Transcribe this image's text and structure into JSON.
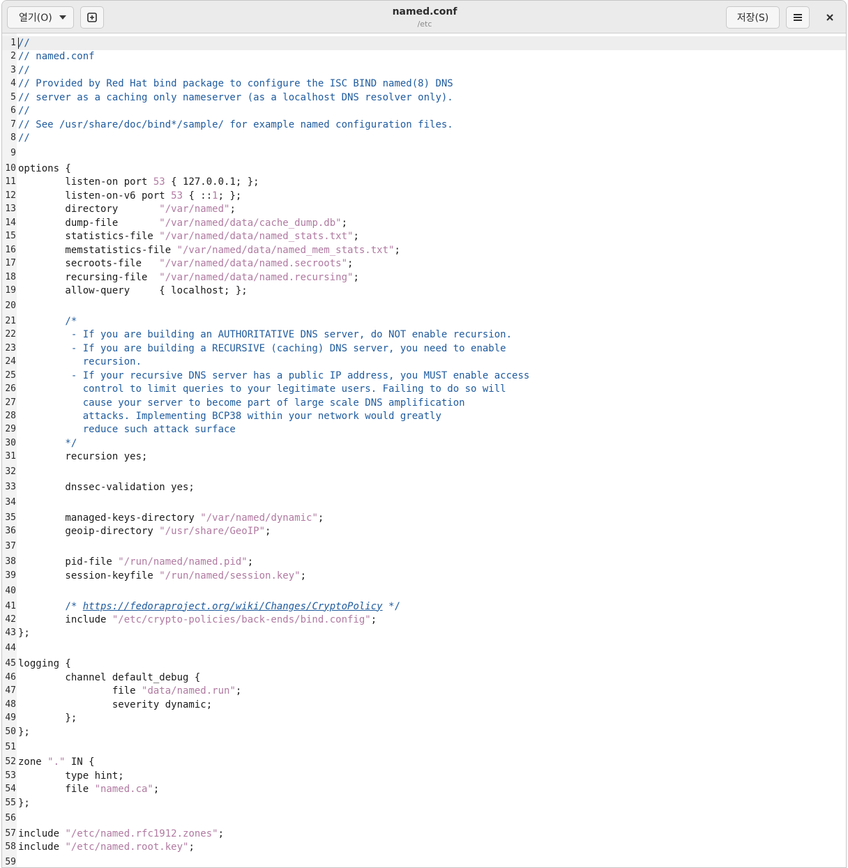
{
  "header": {
    "open_label": "열기(O)",
    "save_label": "저장(S)",
    "title": "named.conf",
    "subtitle": "/etc",
    "new_tab_icon": "new-tab-icon",
    "menu_icon": "hamburger-menu-icon",
    "close_icon": "close-icon"
  },
  "editor": {
    "lines": [
      [
        [
          "c",
          "//"
        ]
      ],
      [
        [
          "c",
          "// named.conf"
        ]
      ],
      [
        [
          "c",
          "//"
        ]
      ],
      [
        [
          "c",
          "// Provided by Red Hat bind package to configure the ISC BIND named(8) DNS"
        ]
      ],
      [
        [
          "c",
          "// server as a caching only nameserver (as a localhost DNS resolver only)."
        ]
      ],
      [
        [
          "c",
          "//"
        ]
      ],
      [
        [
          "c",
          "// See /usr/share/doc/bind*/sample/ for example named configuration files."
        ]
      ],
      [
        [
          "c",
          "//"
        ]
      ],
      [],
      [
        [
          "t",
          "options {"
        ]
      ],
      [
        [
          "t",
          "\tlisten-on port "
        ],
        [
          "n",
          "53"
        ],
        [
          "t",
          " { 127.0.0.1; };"
        ]
      ],
      [
        [
          "t",
          "\tlisten-on-v6 port "
        ],
        [
          "n",
          "53"
        ],
        [
          "t",
          " { ::"
        ],
        [
          "n",
          "1"
        ],
        [
          "t",
          "; };"
        ]
      ],
      [
        [
          "t",
          "\tdirectory \t"
        ],
        [
          "s",
          "\"/var/named\""
        ],
        [
          "t",
          ";"
        ]
      ],
      [
        [
          "t",
          "\tdump-file \t"
        ],
        [
          "s",
          "\"/var/named/data/cache_dump.db\""
        ],
        [
          "t",
          ";"
        ]
      ],
      [
        [
          "t",
          "\tstatistics-file "
        ],
        [
          "s",
          "\"/var/named/data/named_stats.txt\""
        ],
        [
          "t",
          ";"
        ]
      ],
      [
        [
          "t",
          "\tmemstatistics-file "
        ],
        [
          "s",
          "\"/var/named/data/named_mem_stats.txt\""
        ],
        [
          "t",
          ";"
        ]
      ],
      [
        [
          "t",
          "\tsecroots-file\t"
        ],
        [
          "s",
          "\"/var/named/data/named.secroots\""
        ],
        [
          "t",
          ";"
        ]
      ],
      [
        [
          "t",
          "\trecursing-file\t"
        ],
        [
          "s",
          "\"/var/named/data/named.recursing\""
        ],
        [
          "t",
          ";"
        ]
      ],
      [
        [
          "t",
          "\tallow-query     { localhost; };"
        ]
      ],
      [],
      [
        [
          "c",
          "\t/*"
        ]
      ],
      [
        [
          "c",
          "\t - If you are building an AUTHORITATIVE DNS server, do NOT enable recursion."
        ]
      ],
      [
        [
          "c",
          "\t - If you are building a RECURSIVE (caching) DNS server, you need to enable"
        ]
      ],
      [
        [
          "c",
          "\t   recursion."
        ]
      ],
      [
        [
          "c",
          "\t - If your recursive DNS server has a public IP address, you MUST enable access"
        ]
      ],
      [
        [
          "c",
          "\t   control to limit queries to your legitimate users. Failing to do so will"
        ]
      ],
      [
        [
          "c",
          "\t   cause your server to become part of large scale DNS amplification"
        ]
      ],
      [
        [
          "c",
          "\t   attacks. Implementing BCP38 within your network would greatly"
        ]
      ],
      [
        [
          "c",
          "\t   reduce such attack surface"
        ]
      ],
      [
        [
          "c",
          "\t*/"
        ]
      ],
      [
        [
          "t",
          "\trecursion yes;"
        ]
      ],
      [],
      [
        [
          "t",
          "\tdnssec-validation yes;"
        ]
      ],
      [],
      [
        [
          "t",
          "\tmanaged-keys-directory "
        ],
        [
          "s",
          "\"/var/named/dynamic\""
        ],
        [
          "t",
          ";"
        ]
      ],
      [
        [
          "t",
          "\tgeoip-directory "
        ],
        [
          "s",
          "\"/usr/share/GeoIP\""
        ],
        [
          "t",
          ";"
        ]
      ],
      [],
      [
        [
          "t",
          "\tpid-file "
        ],
        [
          "s",
          "\"/run/named/named.pid\""
        ],
        [
          "t",
          ";"
        ]
      ],
      [
        [
          "t",
          "\tsession-keyfile "
        ],
        [
          "s",
          "\"/run/named/session.key\""
        ],
        [
          "t",
          ";"
        ]
      ],
      [],
      [
        [
          "c",
          "\t/* "
        ],
        [
          "u",
          "https://fedoraproject.org/wiki/Changes/CryptoPolicy"
        ],
        [
          "c",
          " */"
        ]
      ],
      [
        [
          "t",
          "\tinclude "
        ],
        [
          "s",
          "\"/etc/crypto-policies/back-ends/bind.config\""
        ],
        [
          "t",
          ";"
        ]
      ],
      [
        [
          "t",
          "};"
        ]
      ],
      [],
      [
        [
          "t",
          "logging {"
        ]
      ],
      [
        [
          "t",
          "        channel default_debug {"
        ]
      ],
      [
        [
          "t",
          "                file "
        ],
        [
          "s",
          "\"data/named.run\""
        ],
        [
          "t",
          ";"
        ]
      ],
      [
        [
          "t",
          "                severity dynamic;"
        ]
      ],
      [
        [
          "t",
          "        };"
        ]
      ],
      [
        [
          "t",
          "};"
        ]
      ],
      [],
      [
        [
          "t",
          "zone "
        ],
        [
          "s",
          "\".\""
        ],
        [
          "t",
          " IN {"
        ]
      ],
      [
        [
          "t",
          "\ttype hint;"
        ]
      ],
      [
        [
          "t",
          "\tfile "
        ],
        [
          "s",
          "\"named.ca\""
        ],
        [
          "t",
          ";"
        ]
      ],
      [
        [
          "t",
          "};"
        ]
      ],
      [],
      [
        [
          "t",
          "include "
        ],
        [
          "s",
          "\"/etc/named.rfc1912.zones\""
        ],
        [
          "t",
          ";"
        ]
      ],
      [
        [
          "t",
          "include "
        ],
        [
          "s",
          "\"/etc/named.root.key\""
        ],
        [
          "t",
          ";"
        ]
      ],
      []
    ]
  }
}
